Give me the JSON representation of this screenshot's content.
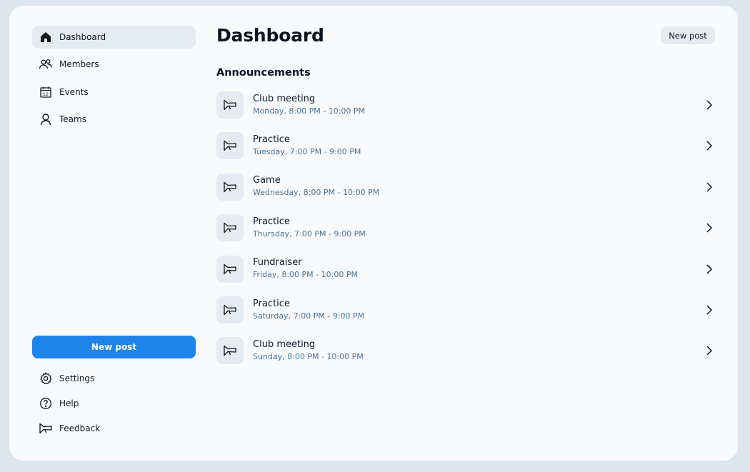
{
  "sidebar": {
    "nav": [
      {
        "label": "Dashboard",
        "icon": "home-icon",
        "active": true
      },
      {
        "label": "Members",
        "icon": "members-icon",
        "active": false
      },
      {
        "label": "Events",
        "icon": "calendar-icon",
        "active": false
      },
      {
        "label": "Teams",
        "icon": "person-icon",
        "active": false
      }
    ],
    "new_post_label": "New post",
    "footer": [
      {
        "label": "Settings",
        "icon": "gear-icon"
      },
      {
        "label": "Help",
        "icon": "help-icon"
      },
      {
        "label": "Feedback",
        "icon": "megaphone-icon"
      }
    ],
    "calendar_icon_day": "12"
  },
  "header": {
    "title": "Dashboard",
    "new_post_label": "New post"
  },
  "announcements": {
    "title": "Announcements",
    "items": [
      {
        "title": "Club meeting",
        "time": "Monday, 8:00 PM - 10:00 PM"
      },
      {
        "title": "Practice",
        "time": "Tuesday, 7:00 PM - 9:00 PM"
      },
      {
        "title": "Game",
        "time": "Wednesday, 8:00 PM - 10:00 PM"
      },
      {
        "title": "Practice",
        "time": "Thursday, 7:00 PM - 9:00 PM"
      },
      {
        "title": "Fundraiser",
        "time": "Friday, 8:00 PM - 10:00 PM"
      },
      {
        "title": "Practice",
        "time": "Saturday, 7:00 PM - 9:00 PM"
      },
      {
        "title": "Club meeting",
        "time": "Sunday, 8:00 PM - 10:00 PM"
      }
    ]
  },
  "colors": {
    "accent": "#1f84e9",
    "subtext": "#4a7297",
    "surface": "#e6ebf2",
    "background": "#dde5ee"
  }
}
